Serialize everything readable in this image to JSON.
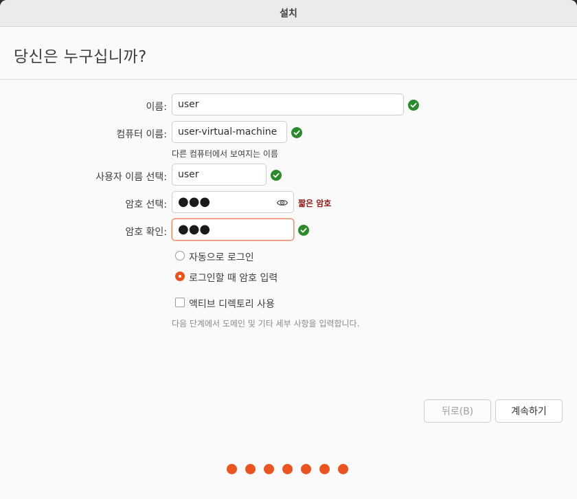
{
  "window": {
    "title": "설치"
  },
  "page": {
    "heading": "당신은 누구십니까?"
  },
  "form": {
    "name": {
      "label": "이름:",
      "value": "user"
    },
    "computer": {
      "label": "컴퓨터 이름:",
      "value": "user-virtual-machine",
      "hint": "다른 컴퓨터에서 보여지는 이름"
    },
    "username": {
      "label": "사용자 이름 선택:",
      "value": "user"
    },
    "password": {
      "label": "암호 선택:",
      "value": "●●●",
      "strength": "짧은 암호"
    },
    "confirm": {
      "label": "암호 확인:",
      "value": "●●●"
    }
  },
  "login": {
    "auto_label": "자동으로 로그인",
    "require_label": "로그인할 때 암호 입력",
    "selected": "require"
  },
  "ad": {
    "label": "액티브 디렉토리 사용",
    "hint": "다음 단계에서 도메인 및 기타 세부 사항을 입력합니다."
  },
  "buttons": {
    "back": "뒤로(B)",
    "continue": "계속하기"
  },
  "progress": {
    "steps": 7
  },
  "colors": {
    "accent": "#e95420",
    "success": "#2b8a2b",
    "warning": "#8b1a1a"
  }
}
